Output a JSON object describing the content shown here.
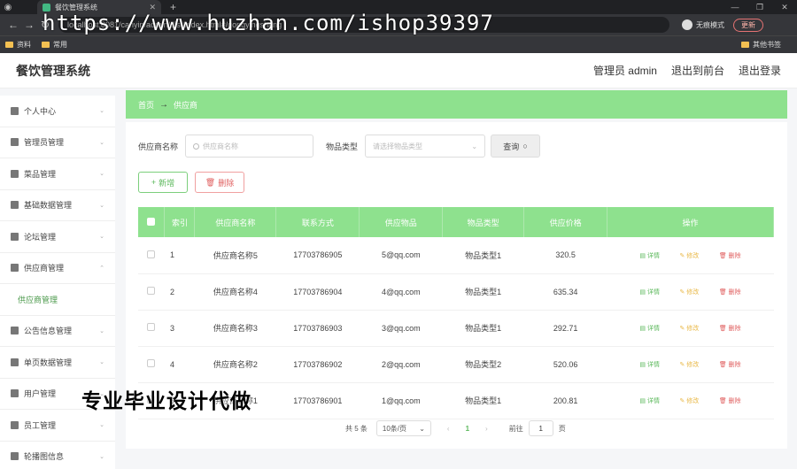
{
  "browser": {
    "tab_title": "餐饮管理系统",
    "address": "localhost:8081/canyin/admin/dist/index.html#/gongyingshang",
    "incognito_label": "无痕模式",
    "update_label": "更新",
    "bookmarks": [
      "资料",
      "常用"
    ],
    "bookmarks_right": "其他书签"
  },
  "watermark_top": "https://www.huzhan.com/ishop39397",
  "header": {
    "title": "餐饮管理系统",
    "user": "管理员 admin",
    "to_front": "退出到前台",
    "logout": "退出登录"
  },
  "sidebar": {
    "items": [
      {
        "label": "个人中心",
        "icon": "user-icon"
      },
      {
        "label": "管理员管理",
        "icon": "admin-icon"
      },
      {
        "label": "菜品管理",
        "icon": "dish-icon"
      },
      {
        "label": "基础数据管理",
        "icon": "data-icon"
      },
      {
        "label": "论坛管理",
        "icon": "forum-icon"
      },
      {
        "label": "供应商管理",
        "icon": "supplier-icon"
      },
      {
        "label": "供应商管理",
        "icon": "",
        "sub": true
      },
      {
        "label": "公告信息管理",
        "icon": "notice-icon"
      },
      {
        "label": "单页数据管理",
        "icon": "page-icon"
      },
      {
        "label": "用户管理",
        "icon": "users-icon"
      },
      {
        "label": "员工管理",
        "icon": "staff-icon"
      },
      {
        "label": "轮播图信息",
        "icon": "carousel-icon"
      }
    ]
  },
  "breadcrumb": {
    "home": "首页",
    "current": "供应商"
  },
  "search": {
    "name_label": "供应商名称",
    "name_placeholder": "供应商名称",
    "type_label": "物品类型",
    "type_placeholder": "请选择物品类型",
    "query_label": "查询"
  },
  "actions": {
    "add": "新增",
    "delete": "删除"
  },
  "table": {
    "headers": [
      "索引",
      "供应商名称",
      "联系方式",
      "供应物品",
      "物品类型",
      "供应价格",
      "操作"
    ],
    "rows": [
      {
        "idx": "1",
        "name": "供应商名称5",
        "phone": "17703786905",
        "item": "5@qq.com",
        "type": "物品类型1",
        "price": "320.5"
      },
      {
        "idx": "2",
        "name": "供应商名称4",
        "phone": "17703786904",
        "item": "4@qq.com",
        "type": "物品类型1",
        "price": "635.34"
      },
      {
        "idx": "3",
        "name": "供应商名称3",
        "phone": "17703786903",
        "item": "3@qq.com",
        "type": "物品类型1",
        "price": "292.71"
      },
      {
        "idx": "4",
        "name": "供应商名称2",
        "phone": "17703786902",
        "item": "2@qq.com",
        "type": "物品类型2",
        "price": "520.06"
      },
      {
        "idx": "5",
        "name": "供应商名称1",
        "phone": "17703786901",
        "item": "1@qq.com",
        "type": "物品类型1",
        "price": "200.81"
      }
    ],
    "ops": {
      "detail": "详情",
      "edit": "修改",
      "remove": "删除"
    }
  },
  "pager": {
    "total": "共 5 条",
    "page_size": "10条/页",
    "current": "1",
    "goto": "前往",
    "goto_value": "1",
    "page_unit": "页"
  },
  "watermark_bottom": "专业毕业设计代做"
}
